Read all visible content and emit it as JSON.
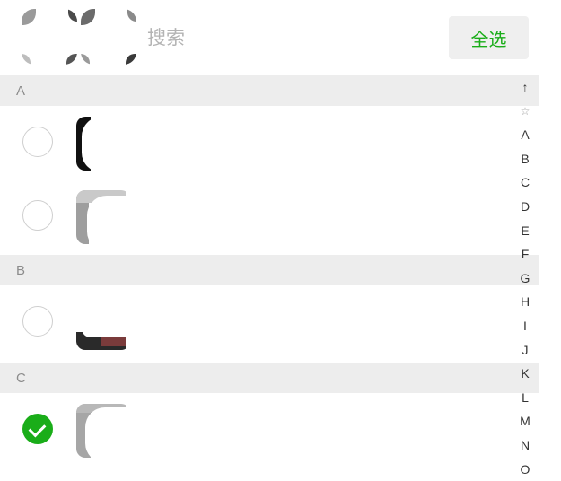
{
  "search": {
    "placeholder": "搜索"
  },
  "header": {
    "select_all_label": "全选"
  },
  "sections": [
    {
      "letter": "A"
    },
    {
      "letter": "B"
    },
    {
      "letter": "C"
    }
  ],
  "contacts": [
    {
      "section": "A",
      "checked": false
    },
    {
      "section": "A",
      "checked": false
    },
    {
      "section": "B",
      "checked": false
    },
    {
      "section": "C",
      "checked": true
    }
  ],
  "index_bar": [
    "↑",
    "☆",
    "A",
    "B",
    "C",
    "D",
    "E",
    "F",
    "G",
    "H",
    "I",
    "J",
    "K",
    "L",
    "M",
    "N",
    "O"
  ],
  "colors": {
    "accent": "#1aad19",
    "section_bg": "#ededed",
    "placeholder": "#b3b3b3"
  }
}
